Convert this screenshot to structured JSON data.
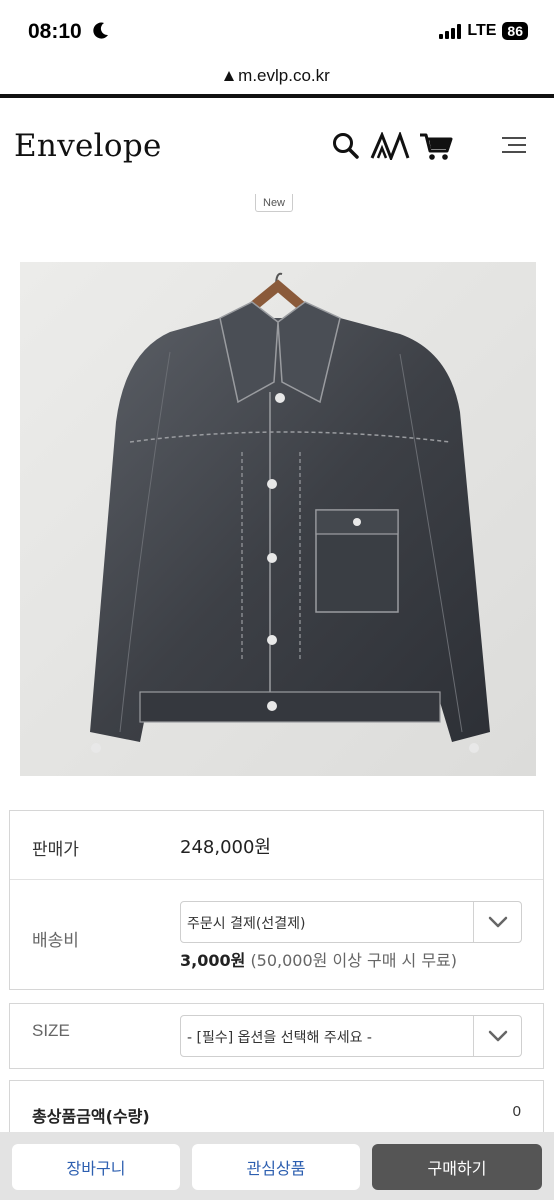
{
  "status_bar": {
    "time": "08:10",
    "network": "LTE",
    "battery": "86"
  },
  "browser": {
    "url": "m.evlp.co.kr"
  },
  "header": {
    "logo": "Envelope",
    "icons": [
      "search-icon",
      "brand-logo-icon",
      "cart-icon",
      "menu-icon"
    ]
  },
  "product": {
    "badge": "New",
    "image": "denim-jacket-photo",
    "price_label": "판매가",
    "price_value": "248,000원",
    "shipping_label": "배송비",
    "shipping_select": "주문시 결제(선결제)",
    "shipping_fee": "3,000원",
    "shipping_note": "(50,000원 이상 구매 시 무료)",
    "size_label": "SIZE",
    "size_select": "- [필수] 옵션을 선택해 주세요 -",
    "total_label": "총상품금액(수량)",
    "total_value": "0"
  },
  "actions": {
    "cart": "장바구니",
    "wishlist": "관심상품",
    "buy": "구매하기"
  },
  "colors": {
    "accent_blue": "#2d5fb0",
    "buy_button": "#555555",
    "bottom_bar": "#e3e3e3"
  }
}
